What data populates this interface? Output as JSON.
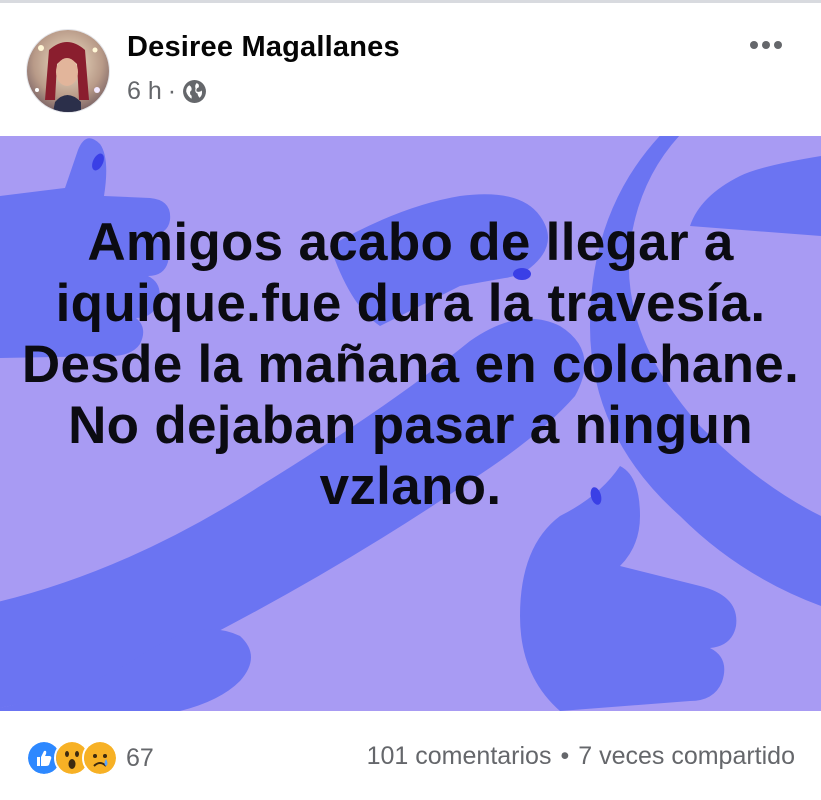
{
  "post": {
    "author": "Desiree Magallanes",
    "time": "6 h",
    "separator": "·",
    "audience_icon": "globe-icon",
    "more_icon": "more-options-icon",
    "text": "Amigos acabo de llegar a iquique.fue dura la travesía. Desde la mañana en colchane. No dejaban pasar a ningun vzlano.",
    "background_color": "#a89bf3",
    "shape_color": "#6b74f2"
  },
  "footer": {
    "reactions": [
      "like-reaction-icon",
      "wow-reaction-icon",
      "sad-reaction-icon"
    ],
    "reaction_count": "67",
    "comments": "101 comentarios",
    "dot": "•",
    "shares": "7 veces compartido"
  }
}
